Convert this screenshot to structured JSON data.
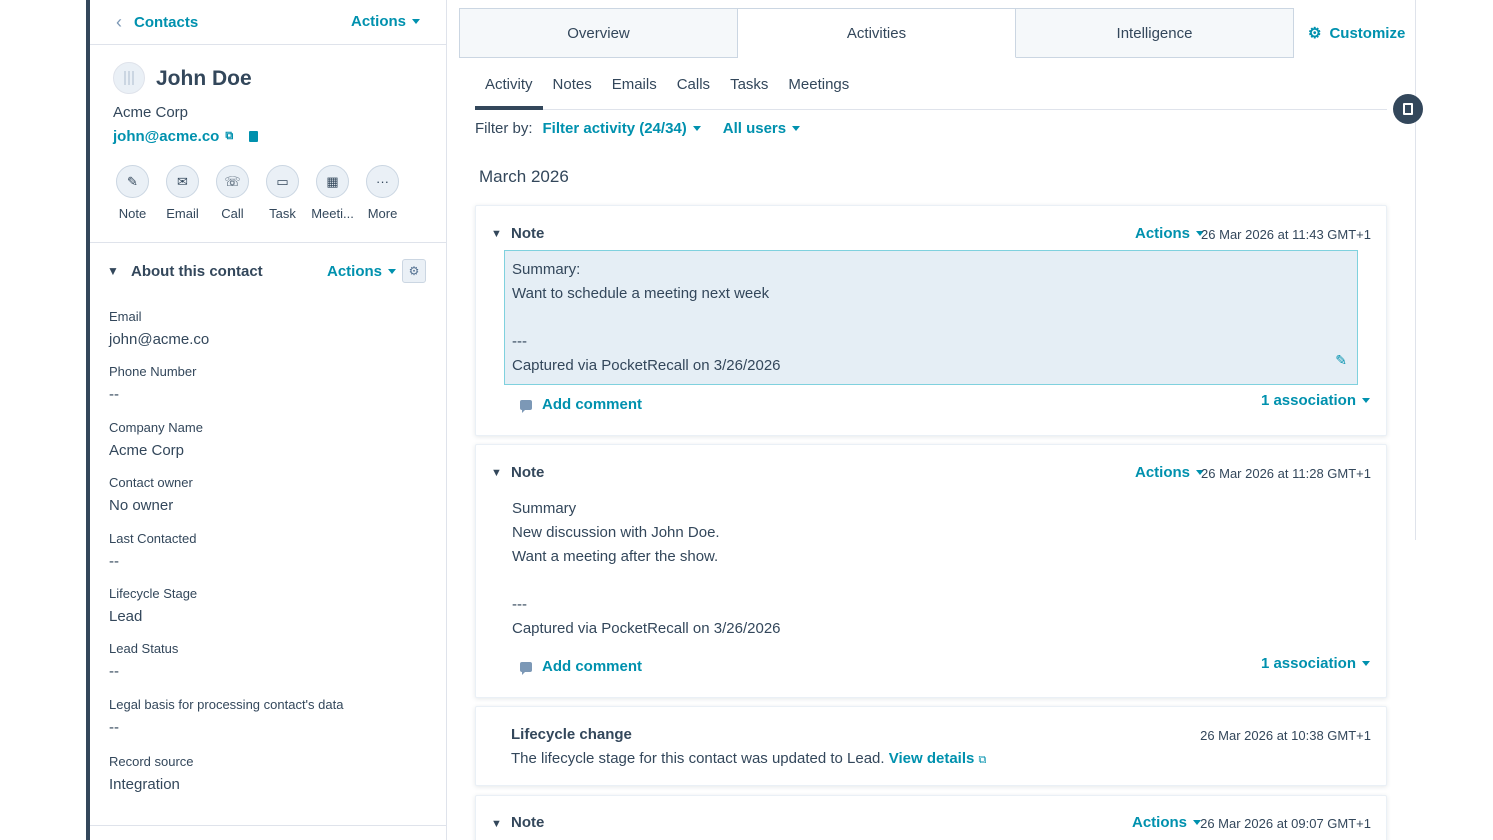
{
  "sidebar": {
    "back_label": "Contacts",
    "actions_label": "Actions",
    "contact": {
      "name": "John Doe",
      "company": "Acme Corp",
      "email": "john@acme.co"
    },
    "quick_actions": [
      {
        "label": "Note",
        "icon": "✎"
      },
      {
        "label": "Email",
        "icon": "✉"
      },
      {
        "label": "Call",
        "icon": "☏"
      },
      {
        "label": "Task",
        "icon": "▭"
      },
      {
        "label": "Meeti...",
        "icon": "▦"
      },
      {
        "label": "More",
        "icon": "···"
      }
    ],
    "about": {
      "title": "About this contact",
      "actions_label": "Actions"
    },
    "properties": [
      {
        "label": "Email",
        "value": "john@acme.co"
      },
      {
        "label": "Phone Number",
        "value": "--"
      },
      {
        "label": "Company Name",
        "value": "Acme Corp"
      },
      {
        "label": "Contact owner",
        "value": "No owner"
      },
      {
        "label": "Last Contacted",
        "value": "--"
      },
      {
        "label": "Lifecycle Stage",
        "value": "Lead"
      },
      {
        "label": "Lead Status",
        "value": "--"
      },
      {
        "label": "Legal basis for processing contact's data",
        "value": "--"
      },
      {
        "label": "Record source",
        "value": "Integration"
      }
    ]
  },
  "main": {
    "tabs": [
      {
        "label": "Overview",
        "active": false
      },
      {
        "label": "Activities",
        "active": true
      },
      {
        "label": "Intelligence",
        "active": false
      }
    ],
    "customize_label": "Customize",
    "subtabs": [
      {
        "label": "Activity",
        "active": true
      },
      {
        "label": "Notes",
        "active": false
      },
      {
        "label": "Emails",
        "active": false
      },
      {
        "label": "Calls",
        "active": false
      },
      {
        "label": "Tasks",
        "active": false
      },
      {
        "label": "Meetings",
        "active": false
      }
    ],
    "filter": {
      "label": "Filter by:",
      "activity": "Filter activity (24/34)",
      "users": "All users"
    },
    "month": "March 2026",
    "cards": [
      {
        "title": "Note",
        "actions_label": "Actions",
        "date": "26 Mar 2026 at 11:43 GMT+1",
        "lines": [
          "Summary:",
          "Want to schedule a meeting next week",
          "",
          "---",
          "Captured via PocketRecall on 3/26/2026"
        ],
        "add_comment": "Add comment",
        "association": "1 association"
      },
      {
        "title": "Note",
        "actions_label": "Actions",
        "date": "26 Mar 2026 at 11:28 GMT+1",
        "lines": [
          "Summary",
          "New discussion with John Doe.",
          "Want a meeting after the show.",
          "",
          "---",
          "Captured via PocketRecall on 3/26/2026"
        ],
        "add_comment": "Add comment",
        "association": "1 association"
      },
      {
        "title": "Lifecycle change",
        "date": "26 Mar 2026 at 10:38 GMT+1",
        "text": "The lifecycle stage for this contact was updated to Lead.",
        "link": "View details"
      },
      {
        "title": "Note",
        "actions_label": "Actions",
        "date": "26 Mar 2026 at 09:07 GMT+1"
      }
    ]
  }
}
